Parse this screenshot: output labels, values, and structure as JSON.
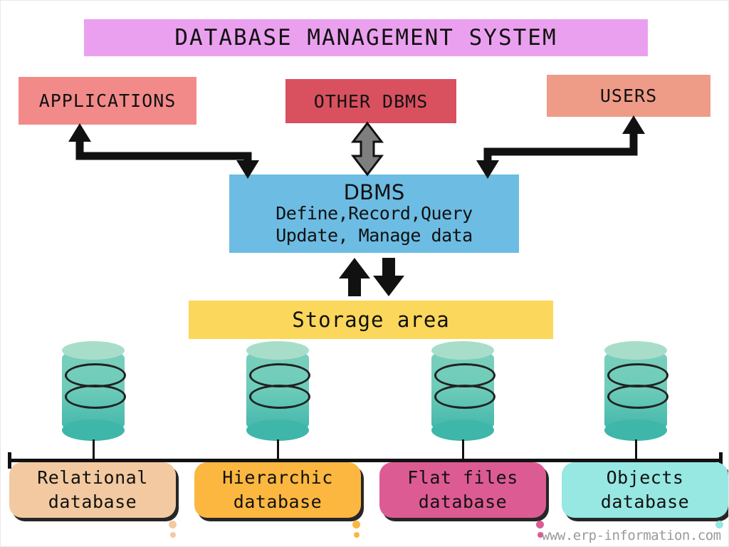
{
  "diagram": {
    "title": "DATABASE MANAGEMENT SYSTEM",
    "title_color": "#EBA0EF",
    "background": "#ffffff"
  },
  "top_boxes": [
    {
      "label": "APPLICATIONS",
      "color": "#F38A8A"
    },
    {
      "label": "OTHER DBMS",
      "color": "#D9505F"
    },
    {
      "label": "USERS",
      "color": "#EE9B88"
    }
  ],
  "core": {
    "heading": "DBMS",
    "line1": "Define,Record,Query",
    "line2": "Update, Manage data",
    "color": "#6DBCE3"
  },
  "storage": {
    "label": "Storage area",
    "color": "#FBD75B"
  },
  "cylinders": [
    {
      "name": "relational-cylinder"
    },
    {
      "name": "hierarchic-cylinder"
    },
    {
      "name": "flatfiles-cylinder"
    },
    {
      "name": "objects-cylinder"
    }
  ],
  "databases": [
    {
      "line1": "Relational",
      "line2": "database",
      "color": "#F2C9A0",
      "dot": "#F2C9A0"
    },
    {
      "line1": "Hierarchic",
      "line2": "database",
      "color": "#FBB740",
      "dot": "#FBB740"
    },
    {
      "line1": "Flat files",
      "line2": "database",
      "color": "#DD5B93",
      "dot": "#DD5B93"
    },
    {
      "line1": "Objects",
      "line2": "database",
      "color": "#97E7E2",
      "dot": "#97E7E2"
    }
  ],
  "connectors": {
    "applications_label": "applications-to-dbms-arrow",
    "other_dbms_label": "other-dbms-bidirectional-arrow",
    "users_label": "users-to-dbms-arrow",
    "storage_up_label": "storage-to-dbms-up-arrow",
    "storage_down_label": "dbms-to-storage-down-arrow",
    "arrow_color": "#111111",
    "other_dbms_arrow_color": "#7E7E7E"
  },
  "watermark": {
    "text": "www.erp-information.com"
  }
}
